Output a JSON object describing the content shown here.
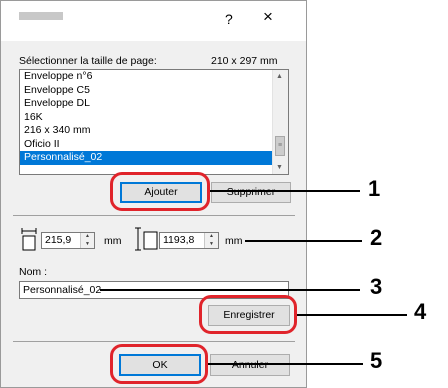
{
  "titlebar": {
    "help_label": "?",
    "close_label": "×"
  },
  "page_size": {
    "label": "Sélectionner la taille de page:",
    "value": "210 x 297 mm"
  },
  "list": {
    "items": [
      "Enveloppe n°6",
      "Enveloppe C5",
      "Enveloppe DL",
      "16K",
      "216 x 340 mm",
      "Oficio II",
      "Personnalisé_02"
    ],
    "selected_index": 6
  },
  "buttons": {
    "add": "Ajouter",
    "delete": "Supprimer",
    "save": "Enregistrer",
    "ok": "OK",
    "cancel": "Annuler"
  },
  "dimensions": {
    "width_value": "215,9",
    "width_unit": "mm",
    "height_value": "1193,8",
    "height_unit": "mm"
  },
  "name": {
    "label": "Nom :",
    "value": "Personnalisé_02"
  },
  "callouts": [
    "1",
    "2",
    "3",
    "4",
    "5"
  ],
  "colors": {
    "highlight_ring": "#e0242b",
    "selection": "#0078d7"
  }
}
